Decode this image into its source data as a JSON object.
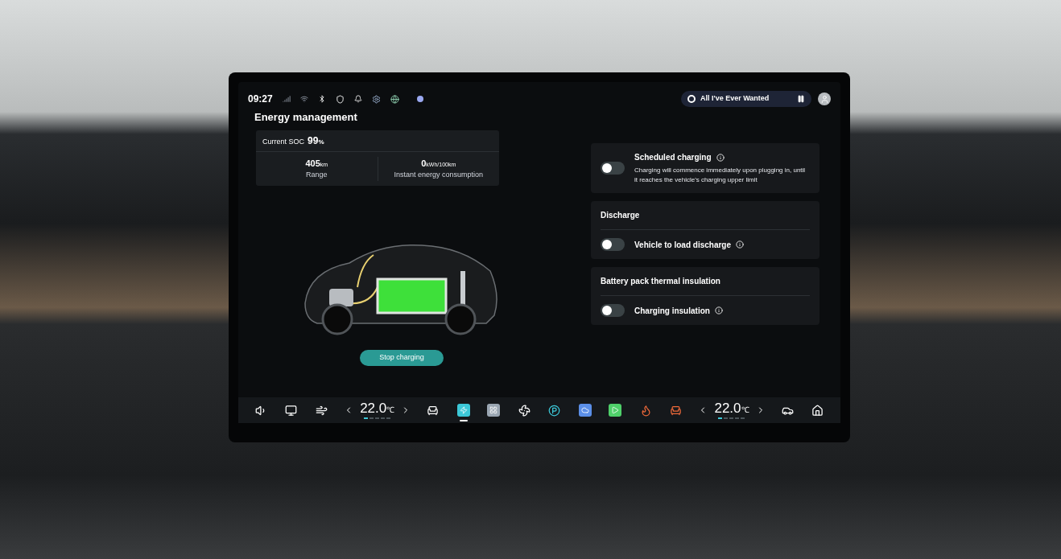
{
  "status_bar": {
    "time": "09:27"
  },
  "media": {
    "title": "All I've Ever Wanted",
    "playing": true
  },
  "page_title": "Energy management",
  "soc": {
    "label": "Current SOC",
    "value": "99",
    "unit": "%"
  },
  "stats": [
    {
      "value": "405",
      "unit": "km",
      "label": "Range"
    },
    {
      "value": "0",
      "unit": "kWh/100km",
      "label": "Instant energy consumption"
    }
  ],
  "stop_button": "Stop charging",
  "settings": [
    {
      "label": "Scheduled charging",
      "description": "Charging will commence immediately upon plugging in, until it reaches the vehicle's charging upper limit",
      "on": false
    },
    {
      "heading": "Discharge",
      "label": "Vehicle to load discharge",
      "on": false
    },
    {
      "heading": "Battery pack thermal insulation",
      "label": "Charging insulation",
      "on": false
    }
  ],
  "dock": [
    {
      "kind": "volume",
      "selected": false
    },
    {
      "kind": "screen",
      "selected": false
    },
    {
      "kind": "defrost",
      "selected": false
    },
    {
      "kind": "temperature",
      "value": "22.0",
      "unit": "℃",
      "level": 0.2
    },
    {
      "kind": "seat",
      "selected": false
    },
    {
      "kind": "energy",
      "selected": true
    },
    {
      "kind": "apps",
      "selected": false
    },
    {
      "kind": "fan",
      "selected": false
    },
    {
      "kind": "parking",
      "selected": false
    },
    {
      "kind": "weather",
      "selected": false
    },
    {
      "kind": "phone",
      "selected": false
    },
    {
      "kind": "wheel",
      "selected": false
    },
    {
      "kind": "seatheat",
      "selected": false
    },
    {
      "kind": "temperature",
      "value": "22.0",
      "unit": "℃",
      "level": 0.2
    },
    {
      "kind": "car",
      "selected": false
    },
    {
      "kind": "home",
      "selected": false
    }
  ]
}
